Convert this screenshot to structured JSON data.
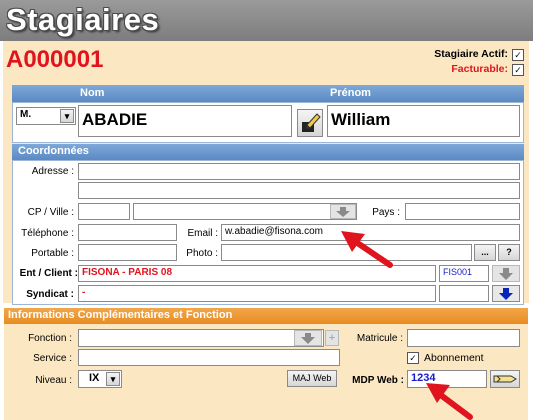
{
  "window": {
    "title": "Stagiaires"
  },
  "record": {
    "id": "A000001"
  },
  "flags": {
    "actif_label": "Stagiaire Actif:",
    "actif_checked": true,
    "facturable_label": "Facturable:",
    "facturable_checked": true
  },
  "identity": {
    "nom_header": "Nom",
    "prenom_header": "Prénom",
    "civilite": "M.",
    "nom": "ABADIE",
    "prenom": "William"
  },
  "coordonnees": {
    "header": "Coordonnées",
    "adresse_label": "Adresse :",
    "adresse1": "",
    "adresse2": "",
    "cp_ville_label": "CP / Ville :",
    "cp": "",
    "ville": "",
    "pays_label": "Pays :",
    "pays": "",
    "telephone_label": "Téléphone :",
    "telephone": "",
    "email_label": "Email :",
    "email": "w.abadie@fisona.com",
    "portable_label": "Portable :",
    "portable": "",
    "photo_label": "Photo :",
    "photo": "",
    "browse_label": "...",
    "help_label": "?",
    "ent_client_label": "Ent / Client :",
    "ent_client": "FISONA - PARIS 08",
    "ent_client_code": "FIS001",
    "syndicat_label": "Syndicat :",
    "syndicat": "-",
    "syndicat_code": ""
  },
  "complementaires": {
    "header": "Informations Complémentaires et Fonction",
    "fonction_label": "Fonction :",
    "fonction": "",
    "add_label": "+",
    "matricule_label": "Matricule :",
    "matricule": "",
    "service_label": "Service :",
    "service": "",
    "abonnement_label": "Abonnement",
    "abonnement_checked": true,
    "niveau_label": "Niveau :",
    "niveau": "IX",
    "maj_web_label": "MAJ Web",
    "mdp_web_label": "MDP Web :",
    "mdp_web": "1234"
  },
  "colors": {
    "accent_red": "#e0141e",
    "header_blue": "#5b89c3",
    "header_orange": "#e88c22",
    "card_bg": "#fbe8c2",
    "link_blue": "#1a1acc"
  }
}
